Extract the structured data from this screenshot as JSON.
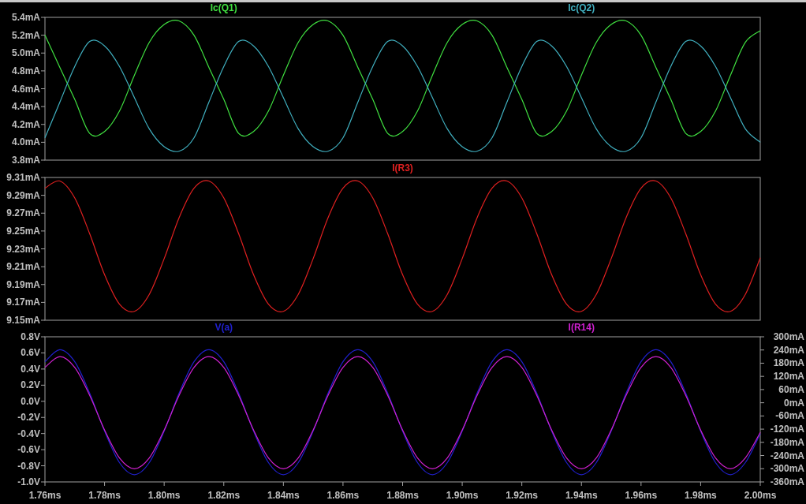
{
  "panes": [
    {
      "chart_data": {
        "type": "line",
        "x": [
          1.76,
          1.765,
          1.77,
          1.775,
          1.78,
          1.785,
          1.79,
          1.795,
          1.8,
          1.805,
          1.81,
          1.815,
          1.82,
          1.825,
          1.83,
          1.835,
          1.84,
          1.845,
          1.85,
          1.855,
          1.86,
          1.865,
          1.87,
          1.875,
          1.88,
          1.885,
          1.89,
          1.895,
          1.9,
          1.905,
          1.91,
          1.915,
          1.92,
          1.925,
          1.93,
          1.935,
          1.94,
          1.945,
          1.95,
          1.955,
          1.96,
          1.965,
          1.97,
          1.975,
          1.98,
          1.985,
          1.99,
          1.995,
          2.0
        ],
        "xlim": [
          1.76,
          2.0
        ],
        "ylim": [
          3.8,
          5.4
        ],
        "yticks": [
          {
            "value": 5.4,
            "label": "5.4mA"
          },
          {
            "value": 5.2,
            "label": "5.2mA"
          },
          {
            "value": 5.0,
            "label": "5.0mA"
          },
          {
            "value": 4.8,
            "label": "4.8mA"
          },
          {
            "value": 4.6,
            "label": "4.6mA"
          },
          {
            "value": 4.4,
            "label": "4.4mA"
          },
          {
            "value": 4.2,
            "label": "4.2mA"
          },
          {
            "value": 4.0,
            "label": "4.0mA"
          },
          {
            "value": 3.8,
            "label": "3.8mA"
          }
        ],
        "series": [
          {
            "name": "Ic(Q1)",
            "color": "#40e040",
            "values": [
              5.2,
              4.84,
              4.48,
              4.1,
              4.12,
              4.35,
              4.75,
              5.12,
              5.32,
              5.36,
              5.2,
              4.84,
              4.48,
              4.1,
              4.12,
              4.35,
              4.75,
              5.12,
              5.32,
              5.36,
              5.2,
              4.84,
              4.48,
              4.1,
              4.12,
              4.35,
              4.75,
              5.12,
              5.32,
              5.36,
              5.2,
              4.84,
              4.48,
              4.1,
              4.12,
              4.35,
              4.75,
              5.12,
              5.32,
              5.36,
              5.2,
              4.84,
              4.48,
              4.1,
              4.12,
              4.35,
              4.75,
              5.12,
              5.25
            ]
          },
          {
            "name": "Ic(Q2)",
            "color": "#40b0c0",
            "values": [
              4.05,
              4.45,
              4.85,
              5.13,
              5.08,
              4.85,
              4.5,
              4.15,
              3.95,
              3.9,
              4.05,
              4.45,
              4.85,
              5.13,
              5.08,
              4.85,
              4.5,
              4.15,
              3.95,
              3.9,
              4.05,
              4.45,
              4.85,
              5.13,
              5.08,
              4.85,
              4.5,
              4.15,
              3.95,
              3.9,
              4.05,
              4.45,
              4.85,
              5.13,
              5.08,
              4.85,
              4.5,
              4.15,
              3.95,
              3.9,
              4.05,
              4.45,
              4.85,
              5.13,
              5.08,
              4.85,
              4.5,
              4.15,
              4.0
            ]
          }
        ]
      }
    },
    {
      "chart_data": {
        "type": "line",
        "x": [
          1.76,
          1.765,
          1.77,
          1.775,
          1.78,
          1.785,
          1.79,
          1.795,
          1.8,
          1.805,
          1.81,
          1.815,
          1.82,
          1.825,
          1.83,
          1.835,
          1.84,
          1.845,
          1.85,
          1.855,
          1.86,
          1.865,
          1.87,
          1.875,
          1.88,
          1.885,
          1.89,
          1.895,
          1.9,
          1.905,
          1.91,
          1.915,
          1.92,
          1.925,
          1.93,
          1.935,
          1.94,
          1.945,
          1.95,
          1.955,
          1.96,
          1.965,
          1.97,
          1.975,
          1.98,
          1.985,
          1.99,
          1.995,
          2.0
        ],
        "xlim": [
          1.76,
          2.0
        ],
        "ylim": [
          9.15,
          9.31
        ],
        "yticks": [
          {
            "value": 9.31,
            "label": "9.31mA"
          },
          {
            "value": 9.29,
            "label": "9.29mA"
          },
          {
            "value": 9.27,
            "label": "9.27mA"
          },
          {
            "value": 9.25,
            "label": "9.25mA"
          },
          {
            "value": 9.23,
            "label": "9.23mA"
          },
          {
            "value": 9.21,
            "label": "9.21mA"
          },
          {
            "value": 9.19,
            "label": "9.19mA"
          },
          {
            "value": 9.17,
            "label": "9.17mA"
          },
          {
            "value": 9.15,
            "label": "9.15mA"
          }
        ],
        "series": [
          {
            "name": "I(R3)",
            "color": "#e02020",
            "values": [
              9.298,
              9.306,
              9.287,
              9.247,
              9.201,
              9.168,
              9.16,
              9.179,
              9.219,
              9.265,
              9.298,
              9.306,
              9.287,
              9.247,
              9.201,
              9.168,
              9.16,
              9.179,
              9.219,
              9.265,
              9.298,
              9.306,
              9.287,
              9.247,
              9.201,
              9.168,
              9.16,
              9.179,
              9.219,
              9.265,
              9.298,
              9.306,
              9.287,
              9.247,
              9.201,
              9.168,
              9.16,
              9.179,
              9.219,
              9.265,
              9.298,
              9.306,
              9.287,
              9.247,
              9.201,
              9.168,
              9.16,
              9.179,
              9.22
            ]
          }
        ]
      }
    },
    {
      "chart_data": {
        "type": "line",
        "x": [
          1.76,
          1.765,
          1.77,
          1.775,
          1.78,
          1.785,
          1.79,
          1.795,
          1.8,
          1.805,
          1.81,
          1.815,
          1.82,
          1.825,
          1.83,
          1.835,
          1.84,
          1.845,
          1.85,
          1.855,
          1.86,
          1.865,
          1.87,
          1.875,
          1.88,
          1.885,
          1.89,
          1.895,
          1.9,
          1.905,
          1.91,
          1.915,
          1.92,
          1.925,
          1.93,
          1.935,
          1.94,
          1.945,
          1.95,
          1.955,
          1.96,
          1.965,
          1.97,
          1.975,
          1.98,
          1.985,
          1.99,
          1.995,
          2.0
        ],
        "xlim": [
          1.76,
          2.0
        ],
        "ylim": [
          -1.0,
          0.8
        ],
        "y2lim": [
          -360,
          300
        ],
        "xticks": [
          {
            "value": 1.76,
            "label": "1.76ms"
          },
          {
            "value": 1.78,
            "label": "1.78ms"
          },
          {
            "value": 1.8,
            "label": "1.80ms"
          },
          {
            "value": 1.82,
            "label": "1.82ms"
          },
          {
            "value": 1.84,
            "label": "1.84ms"
          },
          {
            "value": 1.86,
            "label": "1.86ms"
          },
          {
            "value": 1.88,
            "label": "1.88ms"
          },
          {
            "value": 1.9,
            "label": "1.90ms"
          },
          {
            "value": 1.92,
            "label": "1.92ms"
          },
          {
            "value": 1.94,
            "label": "1.94ms"
          },
          {
            "value": 1.96,
            "label": "1.96ms"
          },
          {
            "value": 1.98,
            "label": "1.98ms"
          },
          {
            "value": 2.0,
            "label": "2.00ms"
          }
        ],
        "yticks": [
          {
            "value": 0.8,
            "label": "0.8V"
          },
          {
            "value": 0.6,
            "label": "0.6V"
          },
          {
            "value": 0.4,
            "label": "0.4V"
          },
          {
            "value": 0.2,
            "label": "0.2V"
          },
          {
            "value": 0.0,
            "label": "0.0V"
          },
          {
            "value": -0.2,
            "label": "-0.2V"
          },
          {
            "value": -0.4,
            "label": "-0.4V"
          },
          {
            "value": -0.6,
            "label": "-0.6V"
          },
          {
            "value": -0.8,
            "label": "-0.8V"
          },
          {
            "value": -1.0,
            "label": "-1.0V"
          }
        ],
        "y2ticks": [
          {
            "value": 300,
            "label": "300mA"
          },
          {
            "value": 240,
            "label": "240mA"
          },
          {
            "value": 180,
            "label": "180mA"
          },
          {
            "value": 120,
            "label": "120mA"
          },
          {
            "value": 60,
            "label": "60mA"
          },
          {
            "value": 0,
            "label": "0mA"
          },
          {
            "value": -60,
            "label": "-60mA"
          },
          {
            "value": -120,
            "label": "-120mA"
          },
          {
            "value": -180,
            "label": "-180mA"
          },
          {
            "value": -240,
            "label": "-240mA"
          },
          {
            "value": -300,
            "label": "-300mA"
          },
          {
            "value": -360,
            "label": "-360mA"
          }
        ],
        "series": [
          {
            "name": "V(a)",
            "color": "#2020d0",
            "values": [
              0.49,
              0.64,
              0.49,
              0.1,
              -0.37,
              -0.76,
              -0.91,
              -0.76,
              -0.37,
              0.1,
              0.49,
              0.64,
              0.49,
              0.1,
              -0.37,
              -0.76,
              -0.91,
              -0.76,
              -0.37,
              0.1,
              0.49,
              0.64,
              0.49,
              0.1,
              -0.37,
              -0.76,
              -0.91,
              -0.76,
              -0.37,
              0.1,
              0.49,
              0.64,
              0.49,
              0.1,
              -0.37,
              -0.76,
              -0.91,
              -0.76,
              -0.37,
              0.1,
              0.49,
              0.64,
              0.49,
              0.1,
              -0.37,
              -0.76,
              -0.91,
              -0.76,
              -0.4
            ]
          },
          {
            "name": "I(R14)",
            "color": "#d020d0",
            "axis": "y2",
            "values": [
              161,
              210,
              161,
              34,
              -124,
              -251,
              -300,
              -251,
              -124,
              34,
              161,
              210,
              161,
              34,
              -124,
              -251,
              -300,
              -251,
              -124,
              34,
              161,
              210,
              161,
              34,
              -124,
              -251,
              -300,
              -251,
              -124,
              34,
              161,
              210,
              161,
              34,
              -124,
              -251,
              -300,
              -251,
              -124,
              34,
              161,
              210,
              161,
              34,
              -124,
              -251,
              -300,
              -251,
              -135
            ]
          }
        ]
      }
    }
  ]
}
